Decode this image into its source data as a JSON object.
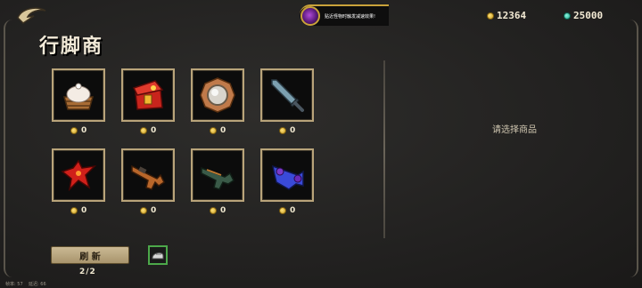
{
  "title": "行脚商",
  "notice": {
    "text": "贴近怪物时触发减速效果!"
  },
  "currency": {
    "gold": "12364",
    "gems": "25000"
  },
  "shop": {
    "items": [
      {
        "name": "dumpling-basket",
        "icon": "dumpling-basket-icon",
        "price": "0"
      },
      {
        "name": "treasure-chest",
        "icon": "treasure-chest-icon",
        "price": "0"
      },
      {
        "name": "round-shield",
        "icon": "round-shield-icon",
        "price": "0"
      },
      {
        "name": "sword",
        "icon": "sword-icon",
        "price": "0"
      },
      {
        "name": "red-dragon-ornament",
        "icon": "red-dragon-icon",
        "price": "0"
      },
      {
        "name": "orange-gun",
        "icon": "orange-gun-icon",
        "price": "0"
      },
      {
        "name": "green-gun",
        "icon": "green-gun-icon",
        "price": "0"
      },
      {
        "name": "blue-cannon",
        "icon": "blue-cannon-icon",
        "price": "0"
      }
    ],
    "placeholder": "请选择商品"
  },
  "refresh": {
    "label": "刷 新",
    "count": "2/2"
  },
  "stats": {
    "fps": "帧率: 57",
    "latency": "延迟: 66"
  },
  "colors": {
    "slot_border": "#b9a47a",
    "accent_gold": "#c9a23a",
    "gem": "#19a58a",
    "selected_slot": "#4ca84a"
  }
}
